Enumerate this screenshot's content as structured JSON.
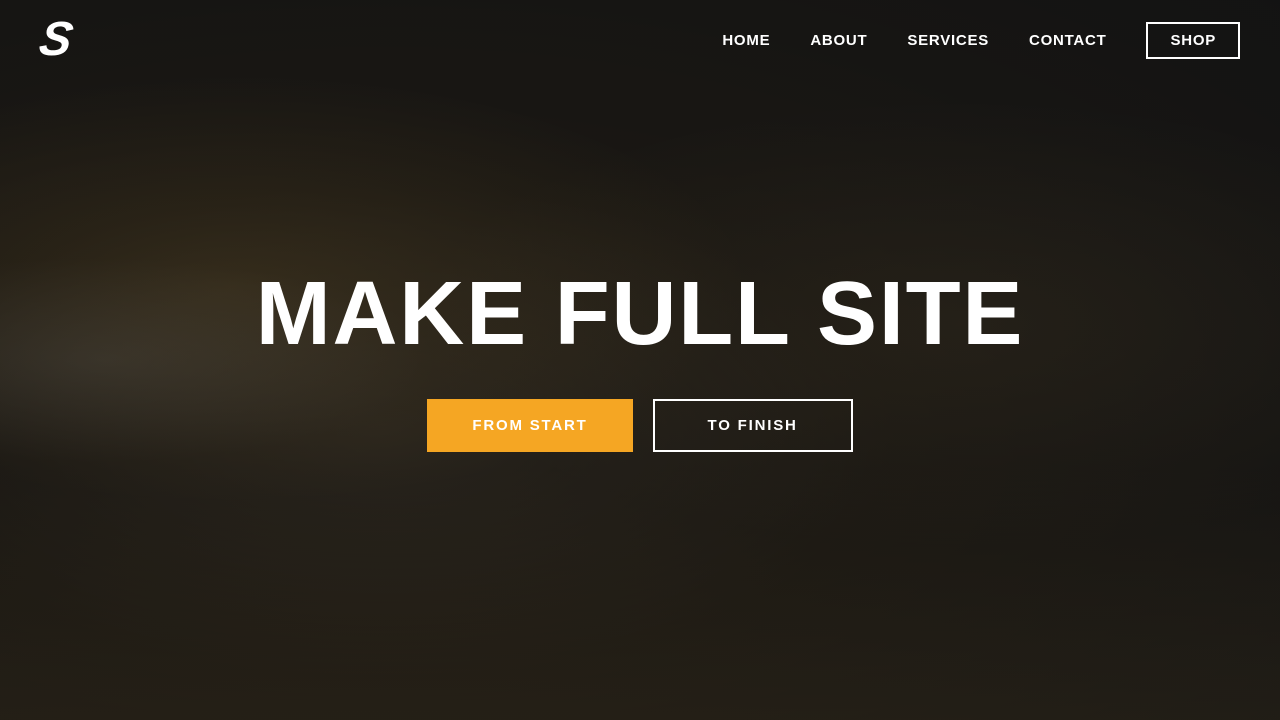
{
  "header": {
    "logo": "S",
    "nav": {
      "items": [
        {
          "label": "HOME",
          "id": "home"
        },
        {
          "label": "ABOUT",
          "id": "about"
        },
        {
          "label": "SERVICES",
          "id": "services"
        },
        {
          "label": "CONTACT",
          "id": "contact"
        },
        {
          "label": "SHOP",
          "id": "shop",
          "highlighted": true
        }
      ]
    }
  },
  "hero": {
    "title": "MAKE FULL SITE",
    "button_primary": "FROM START",
    "button_secondary": "TO FINISH"
  },
  "colors": {
    "accent": "#f5a623",
    "text": "#ffffff",
    "overlay": "rgba(20,20,20,0.72)"
  }
}
